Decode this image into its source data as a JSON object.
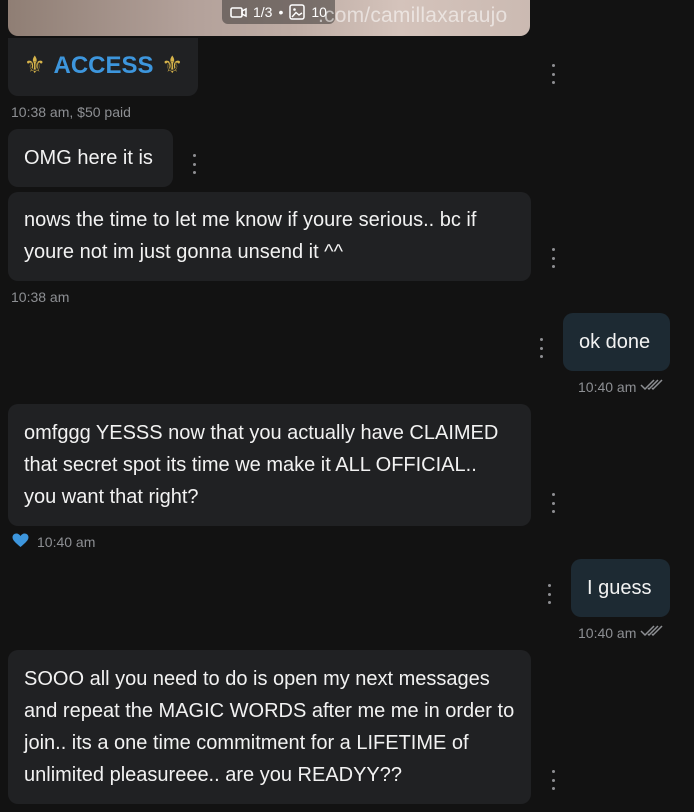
{
  "media_preview": {
    "video_count": "1/3",
    "separator": "•",
    "photo_count": "10",
    "watermark": ".com/camillaxaraujo"
  },
  "messages": [
    {
      "id": "m1",
      "direction": "incoming",
      "icon": "fleur-de-lis-icon",
      "text": "ACCESS",
      "icon_color": "#d6b34a",
      "text_color": "#3d96dd"
    },
    {
      "id": "m2",
      "direction": "incoming",
      "text": "OMG here it is"
    },
    {
      "id": "m3",
      "direction": "incoming",
      "text": "nows the time to let me know if youre serious.. bc if youre not im just gonna unsend it ^^"
    },
    {
      "id": "m4",
      "direction": "outgoing",
      "text": "ok done"
    },
    {
      "id": "m5",
      "direction": "incoming",
      "text": "omfggg YESSS now that you actually have CLAIMED that secret spot its time we make it ALL OFFICIAL.. you want that right?"
    },
    {
      "id": "m6",
      "direction": "outgoing",
      "text": "I guess"
    },
    {
      "id": "m7",
      "direction": "incoming",
      "text": "SOOO all you need to do is open my next messages and repeat the MAGIC WORDS after me me in order to join.. its a one time commitment for a LIFETIME of unlimited pleasureee.. are you READYY??"
    }
  ],
  "meta": {
    "m1_time": "10:38 am,",
    "m1_price": "$50 paid",
    "m3_time": "10:38 am",
    "m4_time": "10:40 am",
    "m5_time": "10:40 am",
    "m6_time": "10:40 am"
  },
  "colors": {
    "background": "#121212",
    "incoming_bubble": "#202123",
    "outgoing_bubble": "#1d2a33",
    "like_heart": "#3d96dd",
    "read_check": "#8d8f93"
  }
}
